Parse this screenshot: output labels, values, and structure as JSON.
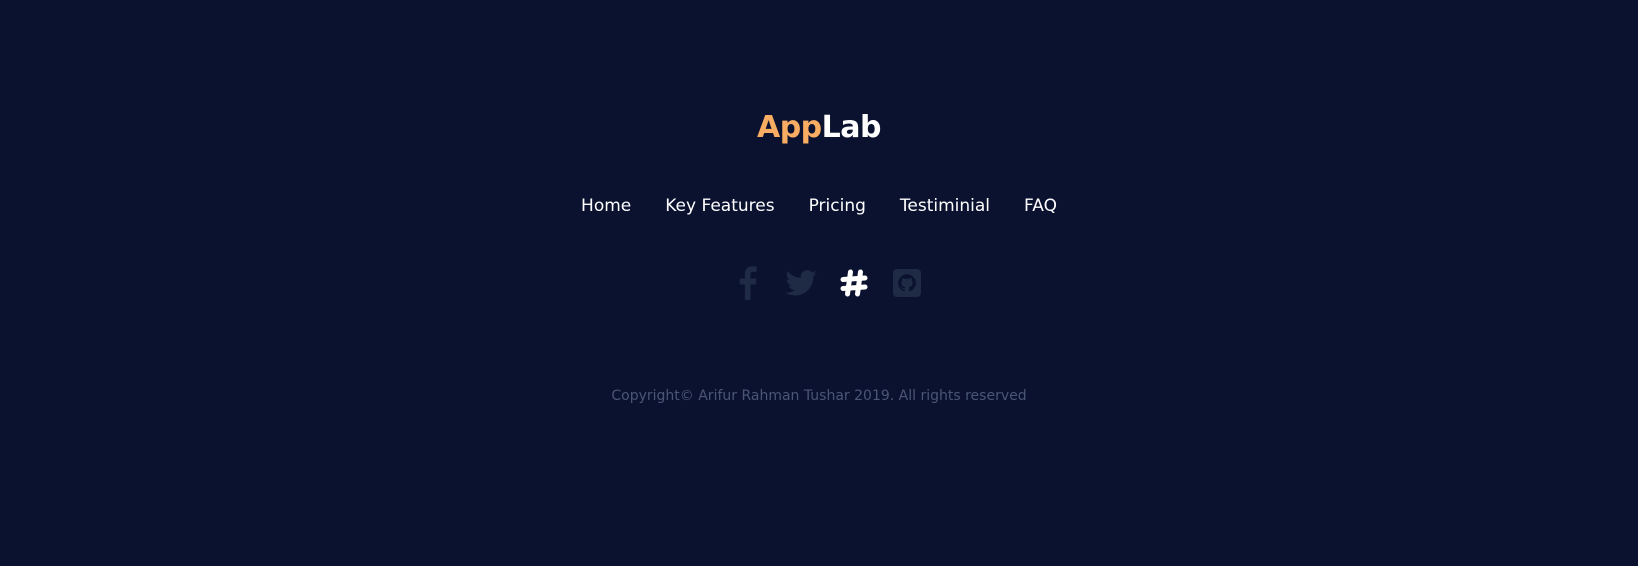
{
  "brand": {
    "part_a": "App",
    "part_b": "Lab",
    "color_a": "#f9ad62",
    "color_b": "#ffffff"
  },
  "nav": {
    "items": [
      {
        "label": "Home"
      },
      {
        "label": "Key Features"
      },
      {
        "label": "Pricing"
      },
      {
        "label": "Testiminial"
      },
      {
        "label": "FAQ"
      }
    ]
  },
  "social": {
    "icons": [
      {
        "name": "facebook-icon",
        "color": "#1f2a45"
      },
      {
        "name": "twitter-icon",
        "color": "#1f2a45"
      },
      {
        "name": "slack-icon",
        "color": "#ffffff",
        "active": true
      },
      {
        "name": "github-icon",
        "color": "#1f2a45"
      }
    ]
  },
  "footer": {
    "copyright": "Copyright© Arifur Rahman Tushar 2019. All rights reserved"
  },
  "colors": {
    "background": "#0a1230",
    "muted_text": "#4b5675"
  }
}
